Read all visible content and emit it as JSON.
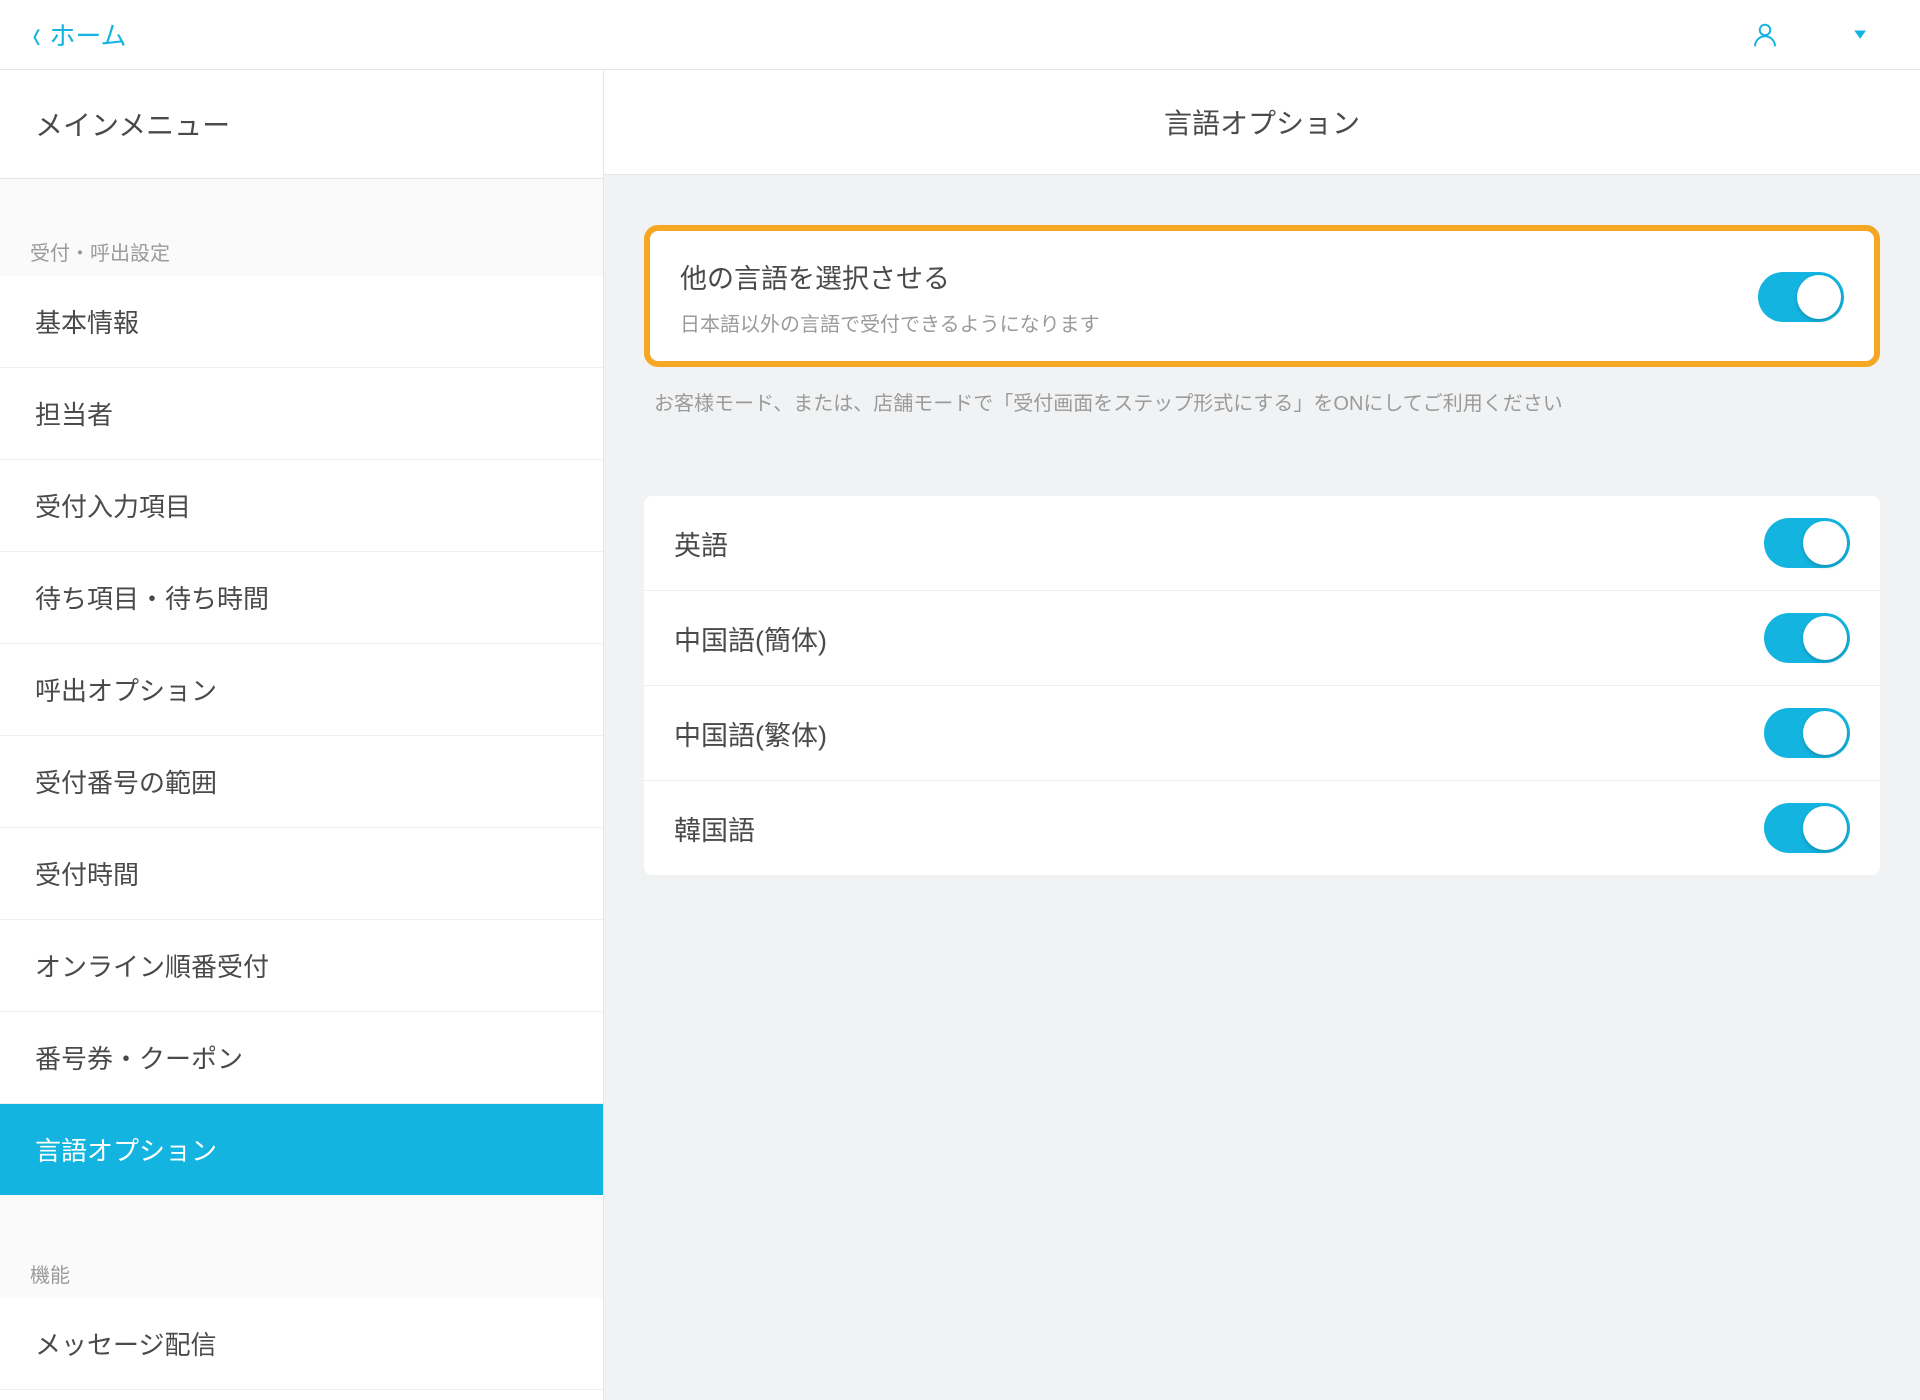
{
  "topbar": {
    "back_label": "ホーム"
  },
  "sidebar": {
    "main_menu_label": "メインメニュー",
    "group1_header": "受付・呼出設定",
    "items": [
      {
        "label": "基本情報"
      },
      {
        "label": "担当者"
      },
      {
        "label": "受付入力項目"
      },
      {
        "label": "待ち項目・待ち時間"
      },
      {
        "label": "呼出オプション"
      },
      {
        "label": "受付番号の範囲"
      },
      {
        "label": "受付時間"
      },
      {
        "label": "オンライン順番受付"
      },
      {
        "label": "番号券・クーポン"
      },
      {
        "label": "言語オプション"
      }
    ],
    "group2_header": "機能",
    "items2": [
      {
        "label": "メッセージ配信"
      }
    ]
  },
  "main": {
    "title": "言語オプション",
    "highlight_title": "他の言語を選択させる",
    "highlight_sub": "日本語以外の言語で受付できるようになります",
    "note": "お客様モード、または、店舗モードで「受付画面をステップ形式にする」をONにしてご利用ください",
    "languages": [
      {
        "label": "英語"
      },
      {
        "label": "中国語(簡体)"
      },
      {
        "label": "中国語(繁体)"
      },
      {
        "label": "韓国語"
      }
    ]
  }
}
